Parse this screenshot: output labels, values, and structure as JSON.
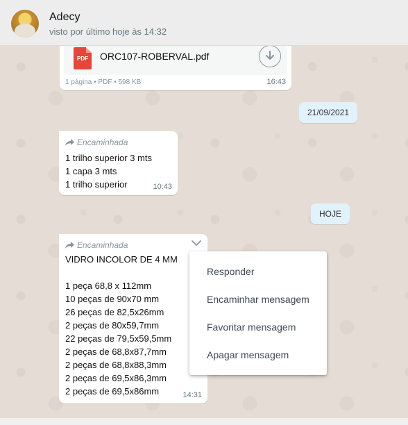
{
  "header": {
    "contact_name": "Adecy",
    "status": "visto por último hoje às 14:32"
  },
  "messages": {
    "pdf": {
      "file_name": "ORC107-ROBERVAL.pdf",
      "icon_label": "PDF",
      "meta": "1 página • PDF • 598 KB",
      "time": "16:43"
    },
    "date_chip": "21/09/2021",
    "forwarded_1": {
      "forwarded_label": "Encaminhada",
      "lines": [
        "1 trilho superior 3 mts",
        "1 capa 3 mts",
        "1 trilho superior"
      ],
      "time": "10:43"
    },
    "today_chip": "HOJE",
    "forwarded_2": {
      "forwarded_label": "Encaminhada",
      "title": "VIDRO INCOLOR DE 4 MM",
      "lines": [
        "1 peça 68,8 x 112mm",
        "10 peças de 90x70 mm",
        "26 peças de 82,5x26mm",
        "2 peças de 80x59,7mm",
        "22 peças de 79,5x59,5mm",
        "2 peças de 68,8x87,7mm",
        "2 peças de 68,8x88,3mm",
        "2 peças de 69,5x86,3mm",
        "2 peças de 69,5x86mm"
      ],
      "time": "14:31"
    }
  },
  "context_menu": {
    "items": [
      "Responder",
      "Encaminhar mensagem",
      "Favoritar mensagem",
      "Apagar mensagem"
    ]
  }
}
